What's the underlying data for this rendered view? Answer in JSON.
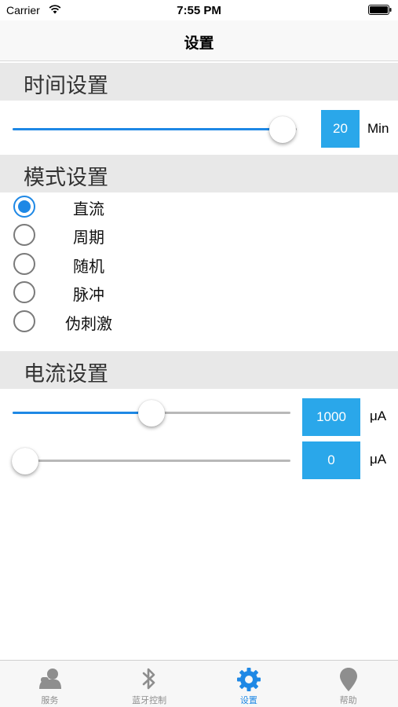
{
  "status_bar": {
    "carrier": "Carrier",
    "time": "7:55 PM"
  },
  "nav": {
    "title": "设置"
  },
  "time_section": {
    "title": "时间设置",
    "slider_fraction": 0.95,
    "value": "20",
    "unit": "Min"
  },
  "mode_section": {
    "title": "模式设置",
    "options": [
      {
        "label": "直流",
        "checked": true
      },
      {
        "label": "周期",
        "checked": false
      },
      {
        "label": "随机",
        "checked": false
      },
      {
        "label": "脉冲",
        "checked": false
      },
      {
        "label": "伪刺激",
        "checked": false
      }
    ]
  },
  "current_section": {
    "title": "电流设置",
    "slider1": {
      "fraction": 0.5,
      "value": "1000",
      "unit": "μA"
    },
    "slider2": {
      "fraction": 0.0,
      "value": "0",
      "unit": "μA"
    }
  },
  "tabs": [
    {
      "label": "服务",
      "icon": "user-support-icon",
      "active": false
    },
    {
      "label": "蓝牙控制",
      "icon": "bluetooth-icon",
      "active": false
    },
    {
      "label": "设置",
      "icon": "gear-icon",
      "active": true
    },
    {
      "label": "帮助",
      "icon": "location-pin-icon",
      "active": false
    }
  ],
  "colors": {
    "accent": "#1e88e5",
    "value_box": "#2aa7ea",
    "section_bg": "#e8e8e8"
  }
}
